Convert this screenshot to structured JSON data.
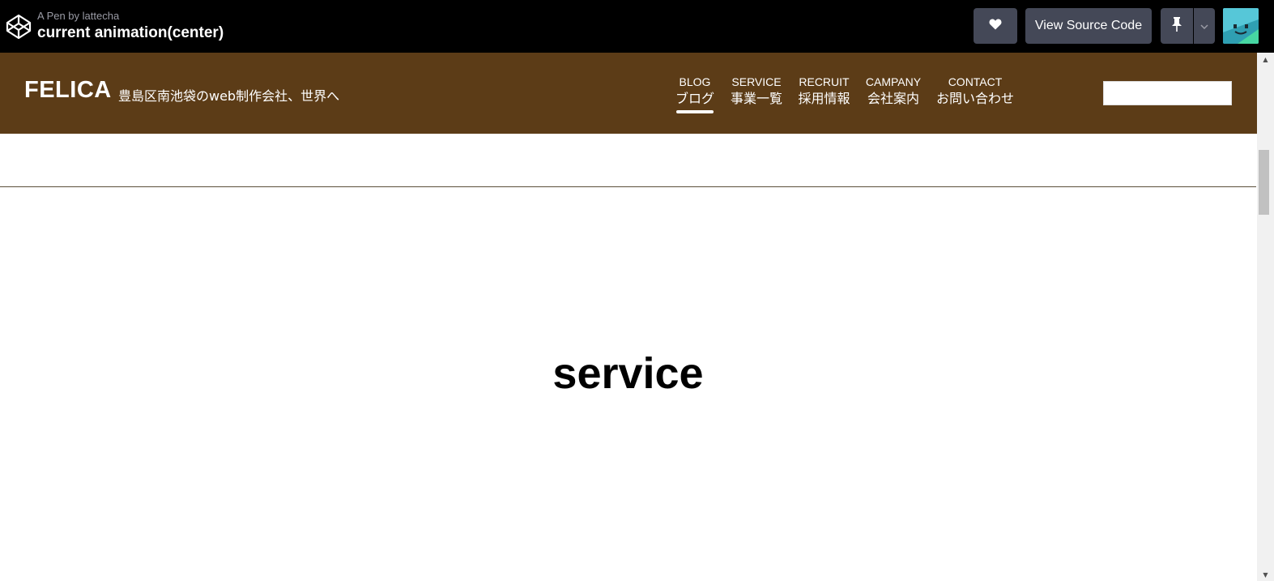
{
  "codepen": {
    "byline": "A Pen by lattecha",
    "title": "current animation(center)",
    "view_source_label": "View Source Code",
    "heart_icon": "heart-icon",
    "pin_icon": "pin-icon",
    "logo_icon": "codepen-logo-icon"
  },
  "site": {
    "brand": "FELICA",
    "tagline": "豊島区南池袋のweb制作会社、世界へ",
    "header_color": "#5c3c17",
    "nav": [
      {
        "en": "BLOG",
        "jp": "ブログ",
        "active": true
      },
      {
        "en": "SERVICE",
        "jp": "事業一覧",
        "active": false
      },
      {
        "en": "RECRUIT",
        "jp": "採用情報",
        "active": false
      },
      {
        "en": "CAMPANY",
        "jp": "会社案内",
        "active": false
      },
      {
        "en": "CONTACT",
        "jp": "お問い合わせ",
        "active": false
      }
    ],
    "search_value": ""
  },
  "main": {
    "section_title": "service"
  }
}
